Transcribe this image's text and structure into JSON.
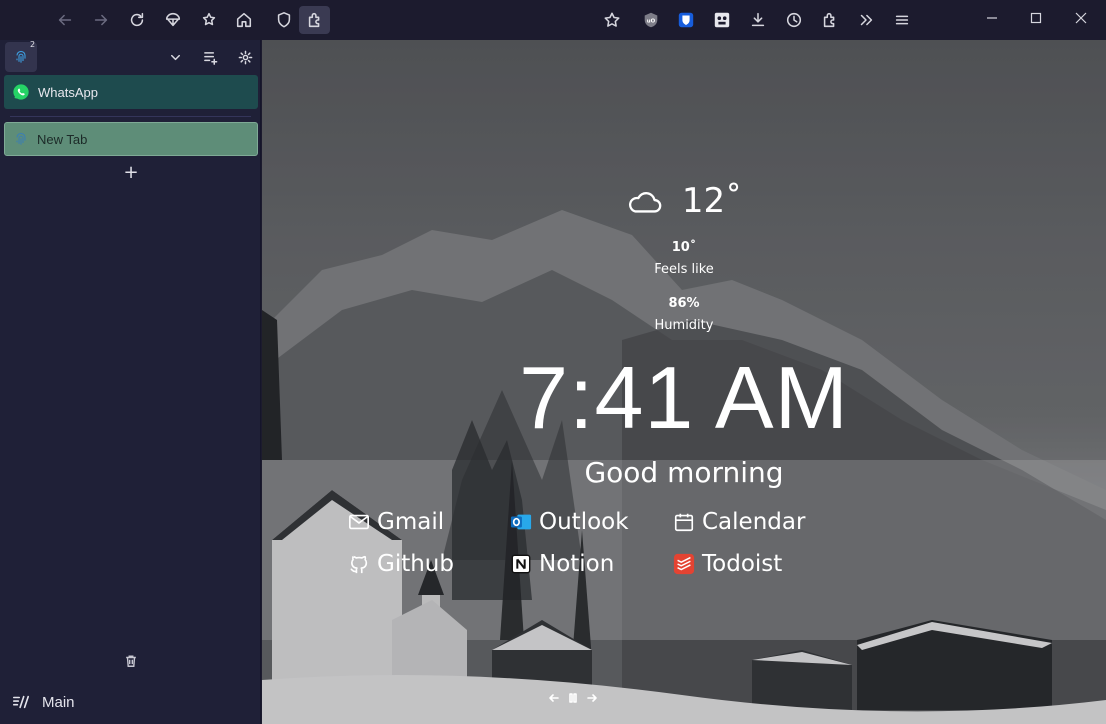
{
  "sidebar": {
    "workspace_count": "2",
    "pinned_tab": {
      "label": "WhatsApp",
      "icon": "whatsapp-icon"
    },
    "tabs": [
      {
        "label": "New Tab",
        "icon": "browser-icon"
      }
    ],
    "add_tab_symbol": "+",
    "workspace_name": "Main"
  },
  "weather": {
    "temperature": "12˚",
    "feels_like_value": "10˚",
    "feels_like_label": "Feels like",
    "humidity_value": "86%",
    "humidity_label": "Humidity",
    "condition_icon": "cloud-icon"
  },
  "clock": {
    "time": "7:41 AM"
  },
  "greeting": "Good morning",
  "links": [
    {
      "label": "Gmail",
      "icon": "mail-icon"
    },
    {
      "label": "Outlook",
      "icon": "outlook-icon"
    },
    {
      "label": "Calendar",
      "icon": "calendar-icon"
    },
    {
      "label": "Github",
      "icon": "github-icon"
    },
    {
      "label": "Notion",
      "icon": "notion-icon"
    },
    {
      "label": "Todoist",
      "icon": "todoist-icon"
    }
  ],
  "colors": {
    "toolbar_bg": "#1c1b2e",
    "sidebar_bg": "#1f2037",
    "pinned_tab_bg": "#1e4b4e",
    "active_tab_bg": "#5e8d78",
    "whatsapp_green": "#25d366",
    "outlook_blue": "#0f6cbd",
    "todoist_red": "#e44332"
  }
}
